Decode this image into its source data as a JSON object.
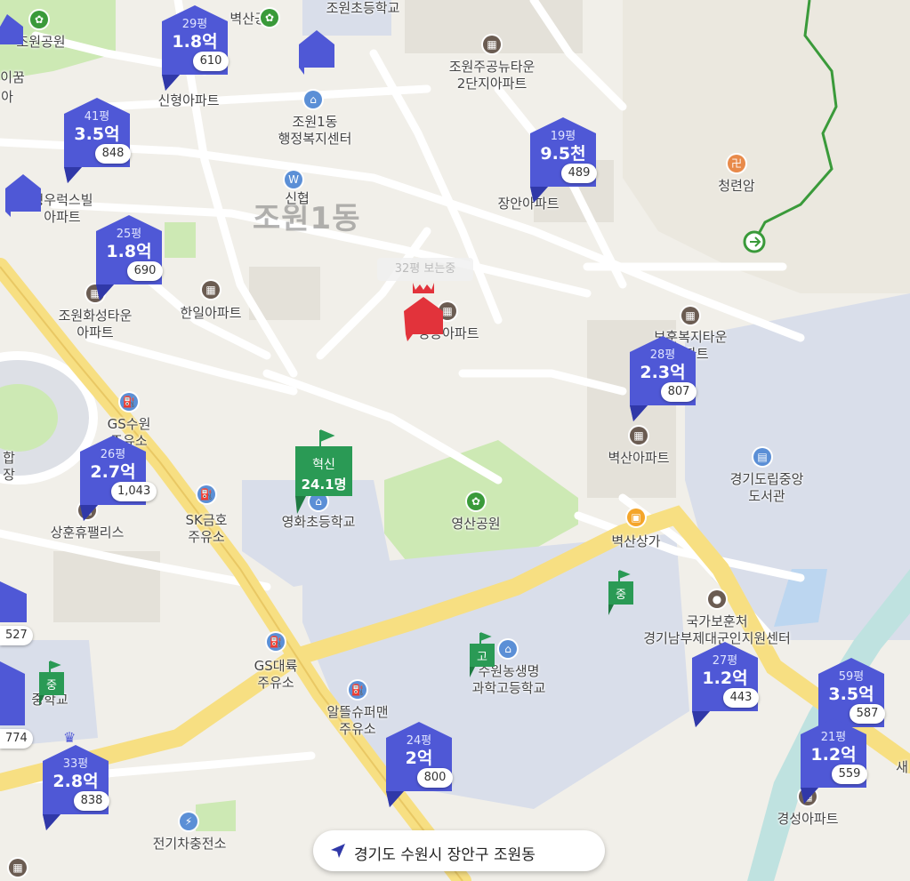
{
  "colors": {
    "map_bg": "#f1efe9",
    "park": "#cde9b4",
    "school_area": "#d9deea",
    "road_major": "#f7df82",
    "road_minor": "#ffffff",
    "block": "#e4e1d9",
    "stream": "#bfe2e0",
    "trail": "#3a9a3a",
    "price_marker": "#4f58d6",
    "price_marker_dark": "#3038a8",
    "selected_marker": "#e2333b",
    "school_flag": "#2a9a55",
    "poi_blue": "#5b8fd6",
    "poi_orange": "#f4a52a",
    "poi_brown": "#6b5c52"
  },
  "district_label": "조원1동",
  "address_bar": {
    "icon": "location-arrow-icon",
    "text": "경기도 수원시 장안구 조원동"
  },
  "price_markers": [
    {
      "pyeong": "29평",
      "price": "1.8억",
      "count": "610"
    },
    {
      "pyeong": "41평",
      "price": "3.5억",
      "count": "848"
    },
    {
      "pyeong": "25평",
      "price": "1.8억",
      "count": "690"
    },
    {
      "pyeong": "19평",
      "price": "9.5천",
      "count": "489"
    },
    {
      "pyeong": "28평",
      "price": "2.3억",
      "count": "807"
    },
    {
      "pyeong": "26평",
      "price": "2.7억",
      "count": "1,043"
    },
    {
      "pyeong": "27평",
      "price": "1.2억",
      "count": "443"
    },
    {
      "pyeong": "59평",
      "price": "3.5억",
      "count": "587"
    },
    {
      "pyeong": "21평",
      "price": "1.2억",
      "count": "559"
    },
    {
      "pyeong": "24평",
      "price": "2억",
      "count": "800"
    },
    {
      "pyeong": "33평",
      "price": "2.8억",
      "count": "838"
    }
  ],
  "partial_markers": [
    {
      "price": "527"
    },
    {
      "price": "774"
    }
  ],
  "selected_marker": {
    "label": "32평 보는중"
  },
  "school_flags": [
    {
      "line1": "혁신",
      "line2": "24.1명"
    },
    {
      "line1": "중",
      "line2": ""
    },
    {
      "line1": "고",
      "line2": ""
    },
    {
      "line1": "중",
      "line2": ""
    }
  ],
  "place_labels": {
    "jowon_park": "조원공원",
    "aikkum": "이꿈",
    "aikkum2": "아",
    "byeoksan_park": "벽산공원",
    "jowon_elem": "조원초등학교",
    "newtown": "조원주공뉴타운\n2단지아파트",
    "sinhyeong": "신형아파트",
    "community_center": "조원1동\n행정복지센터",
    "sinhyup": "신협",
    "cheongryeonam": "청련암",
    "hyeongwoo": "형우럭스빌\n아파트",
    "jangan_apt": "장안아파트",
    "hwaseong_town": "조원화성타운\n아파트",
    "hanil": "한일아파트",
    "gyeongdong": "경동아파트",
    "bohun_town": "보훈복지타운\n아파트",
    "gs_suwon": "GS수원\n주유소",
    "sk_gas": "SK금호\n주유소",
    "yeonghwa_elem": "영화초등학교",
    "yeongsan_park": "영산공원",
    "byeoksan_apt": "벽산아파트",
    "library": "경기도립중앙\n도서관",
    "byeoksan_mall": "벽산상가",
    "sanghun": "상훈휴팰리스",
    "bohun_office": "국가보훈처\n경기남부제대군인지원센터",
    "gs_daeryuk": "GS대륙\n주유소",
    "hap": "합\n장",
    "suwon_highschool": "수원농생명\n과학고등학교",
    "altteul": "알뜰슈퍼맨\n주유소",
    "ev_charge": "전기차충전소",
    "gyeongseong": "경성아파트",
    "jung_school": "중학교",
    "sa": "새"
  }
}
